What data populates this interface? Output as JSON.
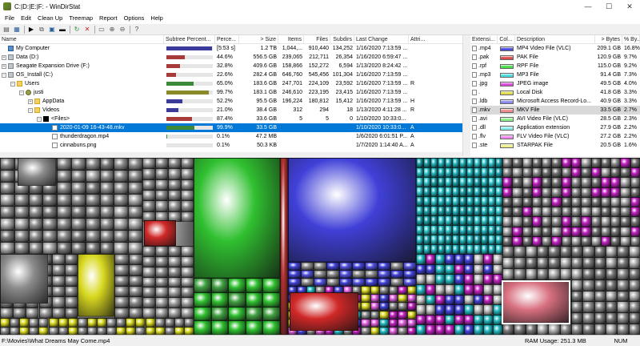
{
  "window": {
    "title": "C:|D:|E:|F: - WinDirStat",
    "minimize": "—",
    "maximize": "☐",
    "close": "✕"
  },
  "menu": [
    "File",
    "Edit",
    "Clean Up",
    "Treemap",
    "Report",
    "Options",
    "Help"
  ],
  "toolbar": {
    "icons": [
      "open-icon",
      "save-icon",
      "play-icon",
      "copy-icon",
      "explorer-icon",
      "cmd-icon",
      "refresh-icon",
      "delete-icon",
      "new-folder-icon",
      "zoom-in-icon",
      "zoom-out-icon",
      "help-icon"
    ],
    "glyphs": [
      "▤",
      "▦",
      "▶",
      "⧉",
      "▣",
      "▬",
      "↻",
      "✕",
      "▭",
      "⊕",
      "⊖",
      "?"
    ]
  },
  "tree": {
    "columns": [
      "Name",
      "Subtree Percent...",
      "Perce...",
      "> Size",
      "Items",
      "Files",
      "Subdirs",
      "Last Change",
      "Attri..."
    ],
    "rows": [
      {
        "indent": 0,
        "icon": "computer",
        "expander": "",
        "name": "My Computer",
        "bar": 0.98,
        "barColor": "#3a3a9a",
        "perc": "[5:53 s]",
        "size": "1.2 TB",
        "items": "1,044,...",
        "files": "910,440",
        "subdirs": "134,252",
        "last": "1/16/2020 7:13:59 ...",
        "attr": ""
      },
      {
        "indent": 0,
        "icon": "drive",
        "expander": "+",
        "name": "Data (D:)",
        "bar": 0.4,
        "barColor": "#a83a3a",
        "perc": "44.6%",
        "size": "556.5 GB",
        "items": "239,065",
        "files": "212,711",
        "subdirs": "26,354",
        "last": "1/16/2020 6:59:47 ...",
        "attr": ""
      },
      {
        "indent": 0,
        "icon": "drive",
        "expander": "+",
        "name": "Seagate Expansion Drive (F:)",
        "bar": 0.3,
        "barColor": "#a83a3a",
        "perc": "32.8%",
        "size": "409.6 GB",
        "items": "158,866",
        "files": "152,272",
        "subdirs": "6,594",
        "last": "1/13/2020 8:24:42 ...",
        "attr": ""
      },
      {
        "indent": 0,
        "icon": "drive",
        "expander": "−",
        "name": "OS_Install (C:)",
        "bar": 0.2,
        "barColor": "#a83a3a",
        "perc": "22.6%",
        "size": "282.4 GB",
        "items": "646,760",
        "files": "545,456",
        "subdirs": "101,304",
        "last": "1/16/2020 7:13:59 ...",
        "attr": ""
      },
      {
        "indent": 1,
        "icon": "folder",
        "expander": "−",
        "name": "Users",
        "bar": 0.58,
        "barColor": "#3a8a3a",
        "perc": "65.0%",
        "size": "183.6 GB",
        "items": "247,701",
        "files": "224,109",
        "subdirs": "23,592",
        "last": "1/16/2020 7:13:59 ...",
        "attr": "R"
      },
      {
        "indent": 2,
        "icon": "user",
        "expander": "−",
        "name": "justi",
        "bar": 0.92,
        "barColor": "#8a8a2a",
        "perc": "99.7%",
        "size": "183.1 GB",
        "items": "246,610",
        "files": "223,195",
        "subdirs": "23,415",
        "last": "1/16/2020 7:13:59 ...",
        "attr": ""
      },
      {
        "indent": 3,
        "icon": "folder",
        "expander": "+",
        "name": "AppData",
        "bar": 0.35,
        "barColor": "#3a3a9a",
        "perc": "52.2%",
        "size": "95.5 GB",
        "items": "196,224",
        "files": "180,812",
        "subdirs": "15,412",
        "last": "1/16/2020 7:13:59 ...",
        "attr": "H"
      },
      {
        "indent": 3,
        "icon": "folder",
        "expander": "−",
        "name": "Videos",
        "bar": 0.25,
        "barColor": "#3a3a9a",
        "perc": "21.0%",
        "size": "38.4 GB",
        "items": "312",
        "files": "294",
        "subdirs": "18",
        "last": "1/13/2020 4:11:28 ...",
        "attr": "R"
      },
      {
        "indent": 4,
        "icon": "files",
        "expander": "−",
        "name": "<Files>",
        "bar": 0.55,
        "barColor": "#a83a3a",
        "perc": "87.4%",
        "size": "33.6 GB",
        "items": "5",
        "files": "5",
        "subdirs": "0",
        "last": "1/10/2020 10:33:0...",
        "attr": ""
      },
      {
        "indent": 5,
        "icon": "file",
        "expander": "",
        "name": "2020-01-09 16-43-48.mkv",
        "bar": 0.6,
        "barColor": "#3a8a3a",
        "perc": "99.9%",
        "size": "33.5 GB",
        "items": "",
        "files": "",
        "subdirs": "",
        "last": "1/10/2020 10:33:0...",
        "attr": "A",
        "selected": true
      },
      {
        "indent": 5,
        "icon": "file",
        "expander": "",
        "name": "thunderdragon.mp4",
        "bar": 0.02,
        "barColor": "#3a8a3a",
        "perc": "0.1%",
        "size": "47.2 MB",
        "items": "",
        "files": "",
        "subdirs": "",
        "last": "1/6/2020 6:01:51 P...",
        "attr": "A"
      },
      {
        "indent": 5,
        "icon": "file",
        "expander": "",
        "name": "cinnabuns.png",
        "bar": 0.0,
        "barColor": "#3a8a3a",
        "perc": "0.1%",
        "size": "50.3 KB",
        "items": "",
        "files": "",
        "subdirs": "",
        "last": "1/7/2020 1:14:40 A...",
        "attr": "A"
      }
    ]
  },
  "extensions": {
    "columns": [
      "Extensi...",
      "Col...",
      "Description",
      "> Bytes",
      "% By..."
    ],
    "rows": [
      {
        "ext": ".mp4",
        "color": "#4a4adc",
        "desc": "MP4 Video File (VLC)",
        "bytes": "209.1 GB",
        "pct": "16.8%"
      },
      {
        "ext": ".pak",
        "color": "#dc4a4a",
        "desc": "PAK File",
        "bytes": "120.9 GB",
        "pct": "9.7%"
      },
      {
        "ext": ".rpf",
        "color": "#4adc4a",
        "desc": "RPF File",
        "bytes": "115.0 GB",
        "pct": "9.2%"
      },
      {
        "ext": ".mp3",
        "color": "#4adcdc",
        "desc": "MP3 File",
        "bytes": "91.4 GB",
        "pct": "7.3%"
      },
      {
        "ext": ".jpg",
        "color": "#dc4adc",
        "desc": "JPEG image",
        "bytes": "49.5 GB",
        "pct": "4.0%"
      },
      {
        "ext": ".",
        "color": "#dcdc4a",
        "desc": "Local Disk",
        "bytes": "41.8 GB",
        "pct": "3.3%"
      },
      {
        "ext": ".ldb",
        "color": "#8a8aee",
        "desc": "Microsoft Access Record-Lo...",
        "bytes": "40.9 GB",
        "pct": "3.3%"
      },
      {
        "ext": ".mkv",
        "color": "#ee8a8a",
        "desc": "MKV File",
        "bytes": "33.5 GB",
        "pct": "2.7%",
        "sel": true
      },
      {
        "ext": ".avi",
        "color": "#8aee8a",
        "desc": "AVI Video File (VLC)",
        "bytes": "28.5 GB",
        "pct": "2.3%"
      },
      {
        "ext": ".dll",
        "color": "#8aeeee",
        "desc": "Application extension",
        "bytes": "27.9 GB",
        "pct": "2.2%"
      },
      {
        "ext": ".flv",
        "color": "#ee8aee",
        "desc": "FLV Video File (VLC)",
        "bytes": "27.2 GB",
        "pct": "2.2%"
      },
      {
        "ext": ".ste",
        "color": "#eeee8a",
        "desc": "STARPAK File",
        "bytes": "20.5 GB",
        "pct": "1.6%"
      }
    ]
  },
  "status": {
    "path": "F:\\Movies\\What Dreams May Come.mp4",
    "ram_label": "RAM Usage:",
    "ram_value": "251.3 MB",
    "num": "NUM"
  },
  "colors": {
    "gray": "#8c8c8c",
    "yellow": "#d8d820",
    "red": "#d02828",
    "green": "#30c030",
    "blue": "#4040d8",
    "cyan": "#20b8c0",
    "magenta": "#c020c0",
    "pink": "#d87080"
  }
}
